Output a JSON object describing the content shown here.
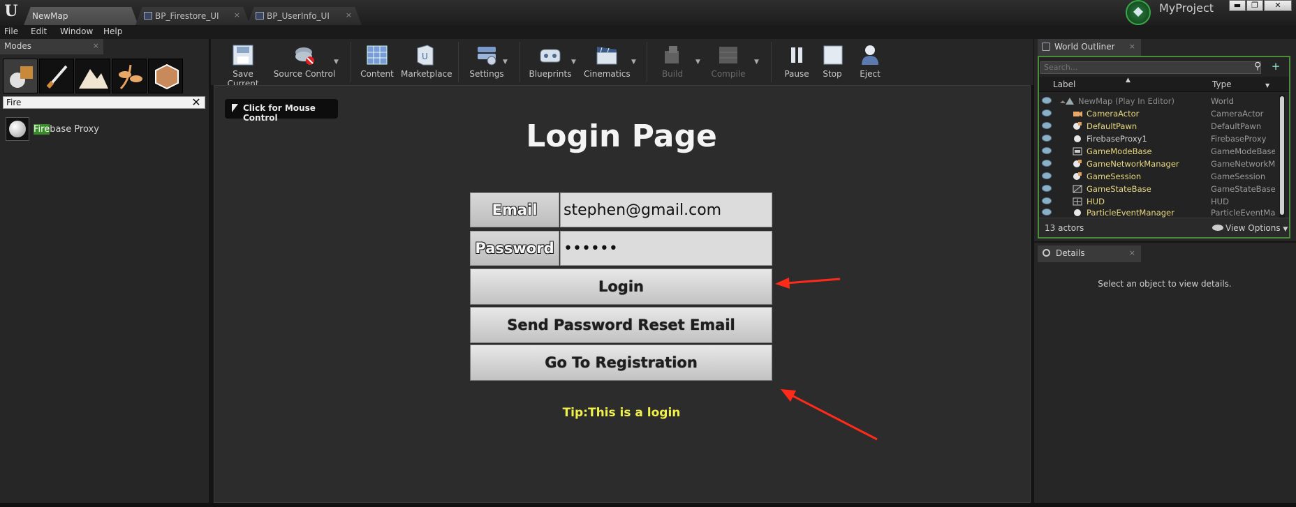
{
  "titlebar": {
    "logo": "U",
    "tabs": [
      {
        "label": "NewMap",
        "active": true
      },
      {
        "label": "BP_Firestore_UI",
        "active": false
      },
      {
        "label": "BP_UserInfo_UI",
        "active": false
      }
    ],
    "project_name": "MyProject",
    "close_glyph": "×",
    "window_buttons": {
      "minimize": "▬",
      "restore": "❐",
      "close": "✕"
    }
  },
  "menu": [
    "File",
    "Edit",
    "Window",
    "Help"
  ],
  "modes": {
    "tab_label": "Modes",
    "tools": [
      "place-mode",
      "paint-mode",
      "landscape-mode",
      "foliage-mode",
      "geometry-mode"
    ],
    "search_value": "Fire",
    "search_clear": "✕",
    "result": {
      "highlight": "Fire",
      "rest": "base Proxy"
    }
  },
  "toolbar": {
    "buttons": [
      {
        "key": "save",
        "label": "Save Current",
        "icon": "save-icon",
        "disabled": false
      },
      {
        "key": "source",
        "label": "Source Control",
        "icon": "source-control-icon",
        "disabled": false
      },
      {
        "key": "content",
        "label": "Content",
        "icon": "content-icon",
        "disabled": false
      },
      {
        "key": "marketplace",
        "label": "Marketplace",
        "icon": "marketplace-icon",
        "disabled": false
      },
      {
        "key": "settings",
        "label": "Settings",
        "icon": "settings-icon",
        "disabled": false
      },
      {
        "key": "blueprints",
        "label": "Blueprints",
        "icon": "blueprints-icon",
        "disabled": false
      },
      {
        "key": "cinematics",
        "label": "Cinematics",
        "icon": "cinematics-icon",
        "disabled": false
      },
      {
        "key": "build",
        "label": "Build",
        "icon": "build-icon",
        "disabled": true
      },
      {
        "key": "compile",
        "label": "Compile",
        "icon": "compile-icon",
        "disabled": true
      },
      {
        "key": "pause",
        "label": "Pause",
        "icon": "pause-icon",
        "disabled": false
      },
      {
        "key": "stop",
        "label": "Stop",
        "icon": "stop-icon",
        "disabled": false
      },
      {
        "key": "eject",
        "label": "Eject",
        "icon": "eject-icon",
        "disabled": false
      }
    ],
    "dropdown_glyph": "▼"
  },
  "viewport": {
    "mouse_control": "Click for Mouse Control",
    "title": "Login Page",
    "email_label": "Email",
    "email_value": "stephen@gmail.com",
    "password_label": "Password",
    "password_value": "••••••",
    "login_button": "Login",
    "reset_button": "Send Password Reset Email",
    "registration_button": "Go To Registration",
    "tip": "Tip:This is a login"
  },
  "outliner": {
    "tab_label": "World Outliner",
    "search_placeholder": "Search...",
    "search_icon": "⚲",
    "add_icon": "+",
    "col_label": "Label",
    "col_type": "Type",
    "sort_glyph": "▲",
    "col_type_glyph": "▼",
    "rows": [
      {
        "name": "NewMap (Play In Editor)",
        "type": "World"
      },
      {
        "name": "CameraActor",
        "type": "CameraActor"
      },
      {
        "name": "DefaultPawn",
        "type": "DefaultPawn"
      },
      {
        "name": "FirebaseProxy1",
        "type": "FirebaseProxy"
      },
      {
        "name": "GameModeBase",
        "type": "GameModeBase"
      },
      {
        "name": "GameNetworkManager",
        "type": "GameNetworkMa"
      },
      {
        "name": "GameSession",
        "type": "GameSession"
      },
      {
        "name": "GameStateBase",
        "type": "GameStateBase"
      },
      {
        "name": "HUD",
        "type": "HUD"
      },
      {
        "name": "ParticleEventManager",
        "type": "ParticleEventMar"
      }
    ],
    "actor_count": "13 actors",
    "view_options": "View Options",
    "view_options_glyph": "▼"
  },
  "details": {
    "tab_label": "Details",
    "empty_message": "Select an object to view details."
  },
  "colors": {
    "accent_green": "#4c8c3c",
    "tip_yellow": "#f0f04a",
    "arrow_red": "#ff2a1a"
  }
}
